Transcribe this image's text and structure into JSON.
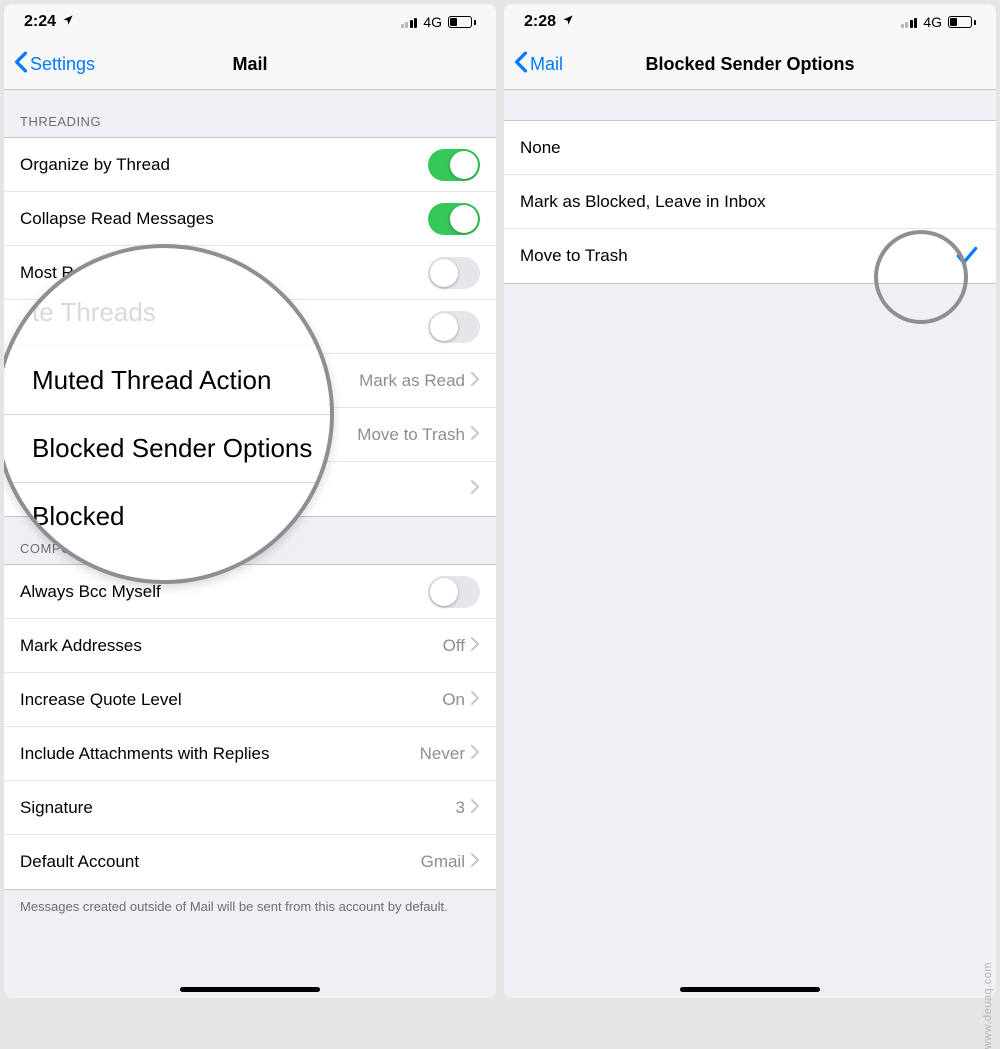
{
  "left": {
    "status": {
      "time": "2:24",
      "network": "4G"
    },
    "nav": {
      "back": "Settings",
      "title": "Mail"
    },
    "section_threading": "Threading",
    "rows": {
      "organize": "Organize by Thread",
      "collapse": "Collapse Read Messages",
      "most_recent": "Most Recent Message on Top",
      "complete": "Complete Threads",
      "muted": "Muted Thread Action",
      "muted_val": "Mark as Read",
      "blocked_sender": "Blocked Sender Options",
      "blocked_sender_val": "Move to Trash",
      "blocked": "Blocked"
    },
    "section_composing": "Composing",
    "composing": {
      "bcc": "Always Bcc Myself",
      "mark_addr": "Mark Addresses",
      "mark_addr_val": "Off",
      "quote": "Increase Quote Level",
      "quote_val": "On",
      "attach": "Include Attachments with Replies",
      "attach_val": "Never",
      "signature": "Signature",
      "signature_val": "3",
      "default_acc": "Default Account",
      "default_acc_val": "Gmail"
    },
    "footer": "Messages created outside of Mail will be sent from this account by default.",
    "magnifier": {
      "r1": "Muted Thread Action",
      "r2": "Blocked Sender Options",
      "r3": "Blocked"
    }
  },
  "right": {
    "status": {
      "time": "2:28",
      "network": "4G"
    },
    "nav": {
      "back": "Mail",
      "title": "Blocked Sender Options"
    },
    "options": {
      "none": "None",
      "mark": "Mark as Blocked, Leave in Inbox",
      "trash": "Move to Trash"
    }
  },
  "watermark": "www.deuaq.com"
}
